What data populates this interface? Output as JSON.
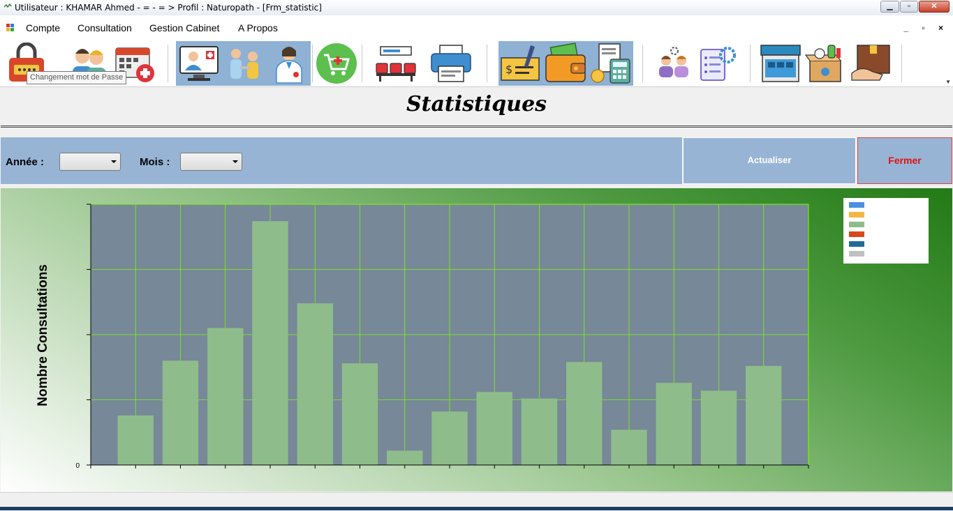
{
  "window": {
    "title": "Utilisateur : KHAMAR  Ahmed - = - = > Profil : Naturopath - [Frm_statistic]",
    "controls": [
      "minimize",
      "maximize",
      "close"
    ]
  },
  "menu": {
    "items": [
      "Compte",
      "Consultation",
      "Gestion Cabinet",
      "A Propos"
    ],
    "mdi_controls": "_ ▫ ×"
  },
  "toolbar": {
    "tooltip": "Changement mot de Passe",
    "tools": [
      {
        "name": "password-lock-icon"
      },
      {
        "name": "patients-icon"
      },
      {
        "name": "calendar-icon"
      },
      {
        "name": "doctor-screen-icon"
      },
      {
        "name": "treatment-icon"
      },
      {
        "name": "doctor-icon"
      },
      {
        "name": "shopping-cart-icon"
      },
      {
        "name": "waiting-room-icon"
      },
      {
        "name": "printer-icon"
      },
      {
        "name": "cheque-icon"
      },
      {
        "name": "wallet-icon"
      },
      {
        "name": "accounting-icon"
      },
      {
        "name": "users-settings-icon"
      },
      {
        "name": "settings-list-icon"
      },
      {
        "name": "pharmacy-store-icon"
      },
      {
        "name": "medicine-box-icon"
      },
      {
        "name": "delivery-box-icon"
      }
    ]
  },
  "page": {
    "title": "Statistiques"
  },
  "filters": {
    "year_label": "Année :",
    "year_value": "",
    "month_label": "Mois :",
    "month_value": "",
    "refresh_label": "Actualiser",
    "close_label": "Fermer"
  },
  "colors": {
    "bar": "#8fbc8b",
    "plot_bg": "#778899",
    "grid": "#7cfc00",
    "accent_close": "#e01010"
  },
  "chart_data": {
    "type": "bar",
    "title": "",
    "xlabel": "",
    "ylabel": "Nombre Consultations",
    "y_tick_labels": [
      "0"
    ],
    "values": [
      19,
      40,
      52.5,
      93.5,
      62,
      39,
      5.5,
      20.5,
      28,
      25.5,
      39.5,
      13.5,
      31.5,
      28.5,
      38
    ],
    "ylim": [
      0,
      100
    ],
    "grid": true,
    "legend": {
      "position": "top-right",
      "swatches": [
        "#4a90e2",
        "#f5b642",
        "#8fbc8b",
        "#d9481a",
        "#1f6d97",
        "#c0c0c0"
      ]
    }
  }
}
